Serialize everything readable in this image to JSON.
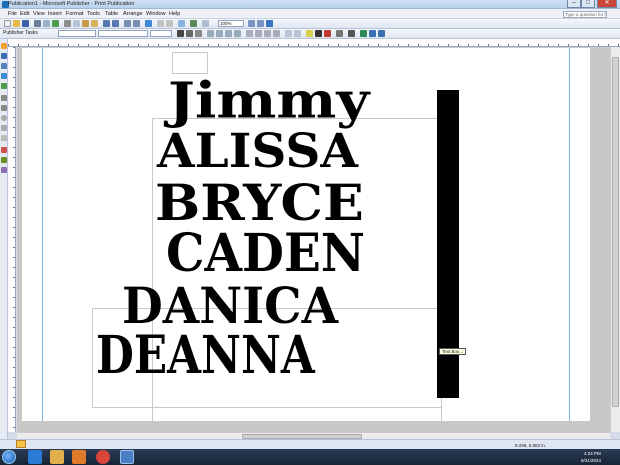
{
  "window": {
    "title": "Publication1 - Microsoft Publisher - Print Publication",
    "minimize_glyph": "–",
    "maximize_glyph": "□",
    "close_glyph": "✕"
  },
  "menu": {
    "items": [
      "File",
      "Edit",
      "View",
      "Insert",
      "Format",
      "Tools",
      "Table",
      "Arrange",
      "Window",
      "Help"
    ],
    "help_placeholder": "Type a question for help"
  },
  "toolbar": {
    "zoom_value": "100%",
    "publisher_tasks_label": "Publisher Tasks"
  },
  "canvas": {
    "names": [
      "Jimmy",
      "ALISSA",
      "BRYCE",
      "CADEN",
      "DANICA",
      "DEANNA"
    ],
    "tooltip": "Text Box..."
  },
  "statusbar": {
    "position_text": "9.299, 6.863 in."
  },
  "taskbar": {
    "time": "4:24 PM",
    "date": "8/31/2024",
    "apps": [
      "internet-explorer",
      "file-explorer",
      "media-player",
      "chrome",
      "publisher"
    ]
  },
  "colors": {
    "accent": "#1c6fb5",
    "guide": "#7fb8e0",
    "text": "#000000"
  }
}
